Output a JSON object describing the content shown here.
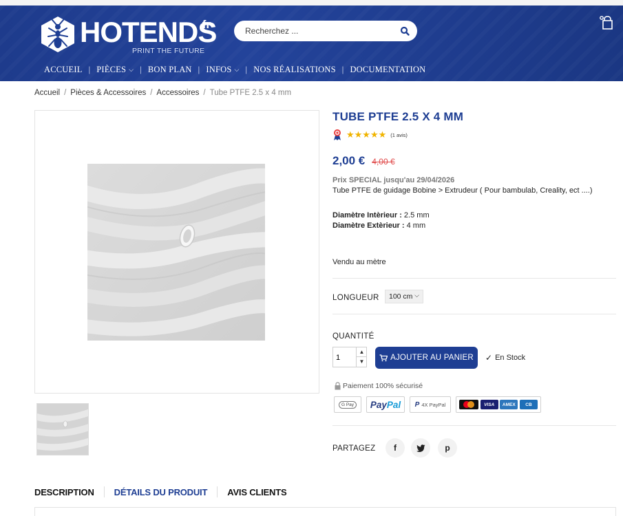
{
  "header": {
    "logo_text": "HOTENDS",
    "logo_suffix": ".fr",
    "tagline": "PRINT THE FUTURE",
    "search_placeholder": "Recherchez ...",
    "brand_color": "#1e3e93"
  },
  "nav": {
    "items": [
      {
        "label": "ACCUEIL"
      },
      {
        "label": "PIÈCES",
        "dropdown": true
      },
      {
        "label": "BON PLAN"
      },
      {
        "label": "INFOS",
        "dropdown": true
      },
      {
        "label": "NOS RÉALISATIONS"
      },
      {
        "label": "DOCUMENTATION"
      }
    ],
    "separator": "|"
  },
  "breadcrumb": {
    "items": [
      "Accueil",
      "Pièces & Accessoires",
      "Accessoires"
    ],
    "current": "Tube PTFE 2.5 x 4 mm",
    "separator": "/"
  },
  "product": {
    "title": "TUBE PTFE 2.5 X 4 MM",
    "rating": 5,
    "stars": "★★★★★",
    "reviews": "(1 avis)",
    "price": "2,00 €",
    "old_price": "4,00 €",
    "special": "Prix SPECIAL jusqu'au 29/04/2026",
    "short_description": "Tube PTFE de guidage Bobine > Extrudeur  ( Pour bambulab, Creality, ect ....)",
    "spec_inner_label": "Diamètre Intèrieur :",
    "spec_inner_value": " 2.5 mm",
    "spec_outer_label": "Diamètre Extèrieur :",
    "spec_outer_value": " 4 mm",
    "sold_by": "Vendu au mètre"
  },
  "options": {
    "length_label": "LONGUEUR",
    "length_value": "100 cm",
    "quantity_label": "QUANTITÉ",
    "quantity_value": "1",
    "add_to_cart": "AJOUTER AU PANIER",
    "stock": "En Stock"
  },
  "payment": {
    "secure_text": "Paiement 100% sécurisé",
    "gpay": "G Pay",
    "paypal_1": "Pay",
    "paypal_2": "Pal",
    "paypal_4x": "4X PayPal",
    "visa": "VISA",
    "amex": "AMEX",
    "cb": "CB"
  },
  "share": {
    "label": "PARTAGEZ",
    "facebook": "f",
    "twitter": "t",
    "pinterest": "p"
  },
  "tabs": [
    {
      "label": "DESCRIPTION",
      "active": false
    },
    {
      "label": "DÉTAILS DU PRODUIT",
      "active": true
    },
    {
      "label": "AVIS CLIENTS",
      "active": false
    }
  ]
}
